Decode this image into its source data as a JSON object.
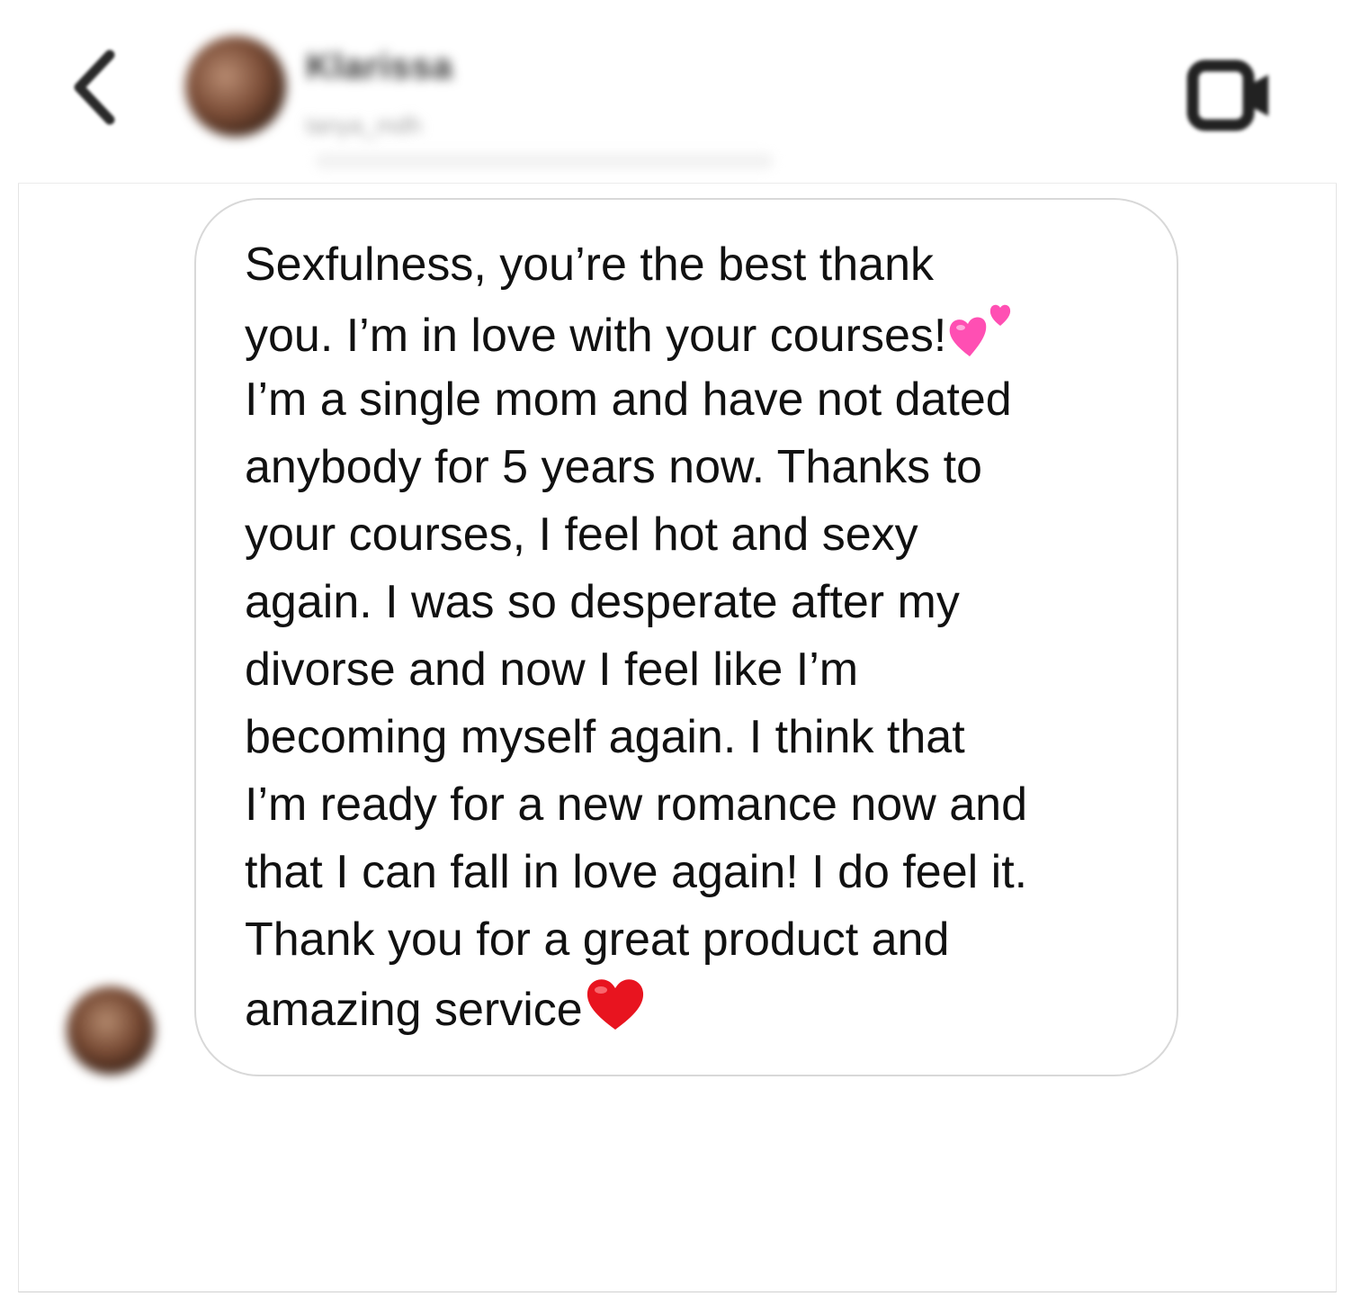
{
  "header": {
    "contact_name": "Klarissa",
    "contact_subtitle": "tanya_mdh",
    "back_icon": "chevron-left-icon",
    "video_icon": "video-camera-icon"
  },
  "message": {
    "lines": [
      "Sexfulness, you’re the best thank",
      "you. I’m in love with your courses!",
      "I’m a single mom and have not dated",
      "anybody for 5 years now. Thanks to",
      "your courses, I feel hot and sexy",
      "again. I was so desperate after my",
      "divorse and now I feel like I’m",
      "becoming myself again. I think that",
      "I’m ready for a new romance now and",
      "that I can fall in love again! I do feel it.",
      "Thank you for a great product and",
      "amazing service"
    ],
    "emoji_after_line_2": "two-hearts-icon",
    "emoji_after_line_12": "red-heart-icon"
  },
  "colors": {
    "text": "#111111",
    "bubble_border": "#d8d8d8",
    "background": "#ffffff",
    "two_hearts": "#ff4fb3",
    "red_heart": "#e8141f"
  }
}
